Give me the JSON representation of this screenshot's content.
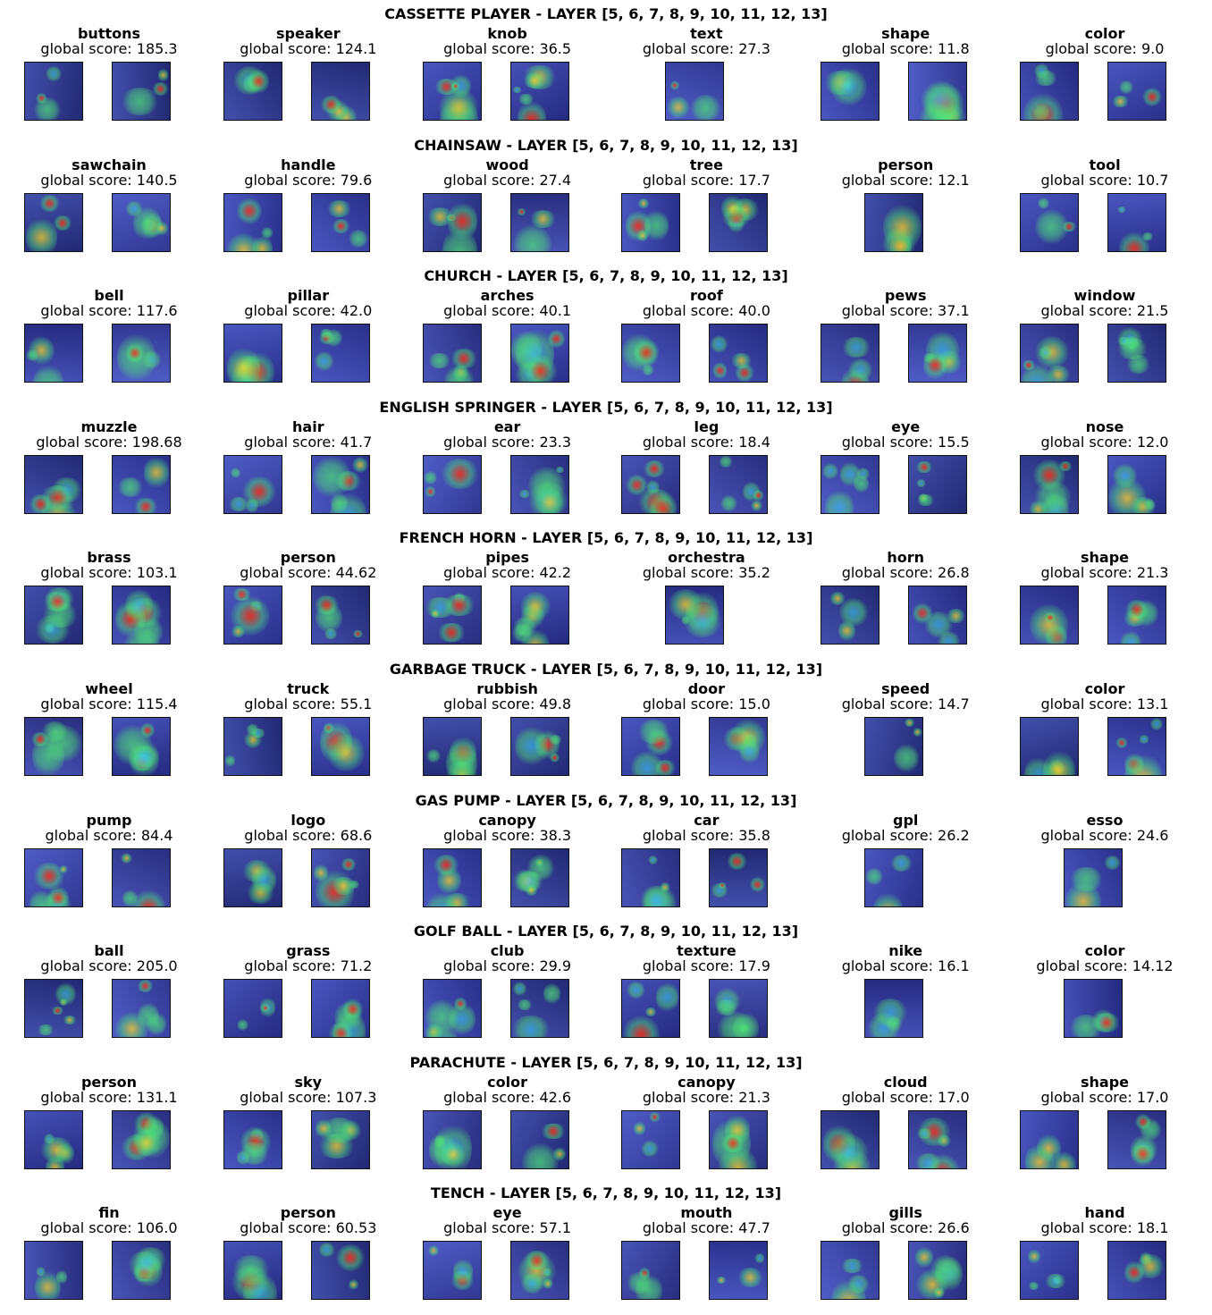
{
  "sections": [
    {
      "title": "CASSETTE PLAYER - LAYER [5, 6, 7, 8, 9, 10, 11, 12, 13]",
      "concepts": [
        {
          "name": "buttons",
          "score": "global score: 185.3",
          "thumbs": 2
        },
        {
          "name": "speaker",
          "score": "global score: 124.1",
          "thumbs": 2
        },
        {
          "name": "knob",
          "score": "global score: 36.5",
          "thumbs": 2
        },
        {
          "name": "text",
          "score": "global score: 27.3",
          "thumbs": 1
        },
        {
          "name": "shape",
          "score": "global score: 11.8",
          "thumbs": 2
        },
        {
          "name": "color",
          "score": "global score: 9.0",
          "thumbs": 2
        }
      ]
    },
    {
      "title": "CHAINSAW - LAYER [5, 6, 7, 8, 9, 10, 11, 12, 13]",
      "concepts": [
        {
          "name": "sawchain",
          "score": "global score: 140.5",
          "thumbs": 2
        },
        {
          "name": "handle",
          "score": "global score: 79.6",
          "thumbs": 2
        },
        {
          "name": "wood",
          "score": "global score: 27.4",
          "thumbs": 2
        },
        {
          "name": "tree",
          "score": "global score: 17.7",
          "thumbs": 2
        },
        {
          "name": "person",
          "score": "global score: 12.1",
          "thumbs": 1
        },
        {
          "name": "tool",
          "score": "global score: 10.7",
          "thumbs": 2
        }
      ]
    },
    {
      "title": "CHURCH - LAYER [5, 6, 7, 8, 9, 10, 11, 12, 13]",
      "concepts": [
        {
          "name": "bell",
          "score": "global score: 117.6",
          "thumbs": 2
        },
        {
          "name": "pillar",
          "score": "global score: 42.0",
          "thumbs": 2
        },
        {
          "name": "arches",
          "score": "global score: 40.1",
          "thumbs": 2
        },
        {
          "name": "roof",
          "score": "global score: 40.0",
          "thumbs": 2
        },
        {
          "name": "pews",
          "score": "global score: 37.1",
          "thumbs": 2
        },
        {
          "name": "window",
          "score": "global score: 21.5",
          "thumbs": 2
        }
      ]
    },
    {
      "title": "ENGLISH SPRINGER - LAYER [5, 6, 7, 8, 9, 10, 11, 12, 13]",
      "concepts": [
        {
          "name": "muzzle",
          "score": "global score: 198.68",
          "thumbs": 2
        },
        {
          "name": "hair",
          "score": "global score: 41.7",
          "thumbs": 2
        },
        {
          "name": "ear",
          "score": "global score: 23.3",
          "thumbs": 2
        },
        {
          "name": "leg",
          "score": "global score: 18.4",
          "thumbs": 2
        },
        {
          "name": "eye",
          "score": "global score: 15.5",
          "thumbs": 2
        },
        {
          "name": "nose",
          "score": "global score: 12.0",
          "thumbs": 2
        }
      ]
    },
    {
      "title": "FRENCH HORN - LAYER [5, 6, 7, 8, 9, 10, 11, 12, 13]",
      "concepts": [
        {
          "name": "brass",
          "score": "global score: 103.1",
          "thumbs": 2
        },
        {
          "name": "person",
          "score": "global score: 44.62",
          "thumbs": 2
        },
        {
          "name": "pipes",
          "score": "global score: 42.2",
          "thumbs": 2
        },
        {
          "name": "orchestra",
          "score": "global score: 35.2",
          "thumbs": 1
        },
        {
          "name": "horn",
          "score": "global score: 26.8",
          "thumbs": 2
        },
        {
          "name": "shape",
          "score": "global score: 21.3",
          "thumbs": 2
        }
      ]
    },
    {
      "title": "GARBAGE TRUCK - LAYER [5, 6, 7, 8, 9, 10, 11, 12, 13]",
      "concepts": [
        {
          "name": "wheel",
          "score": "global score: 115.4",
          "thumbs": 2
        },
        {
          "name": "truck",
          "score": "global score: 55.1",
          "thumbs": 2
        },
        {
          "name": "rubbish",
          "score": "global score: 49.8",
          "thumbs": 2
        },
        {
          "name": "door",
          "score": "global score: 15.0",
          "thumbs": 2
        },
        {
          "name": "speed",
          "score": "global score: 14.7",
          "thumbs": 1
        },
        {
          "name": "color",
          "score": "global score: 13.1",
          "thumbs": 2
        }
      ]
    },
    {
      "title": "GAS PUMP - LAYER [5, 6, 7, 8, 9, 10, 11, 12, 13]",
      "concepts": [
        {
          "name": "pump",
          "score": "global score: 84.4",
          "thumbs": 2
        },
        {
          "name": "logo",
          "score": "global score: 68.6",
          "thumbs": 2
        },
        {
          "name": "canopy",
          "score": "global score: 38.3",
          "thumbs": 2
        },
        {
          "name": "car",
          "score": "global score: 35.8",
          "thumbs": 2
        },
        {
          "name": "gpl",
          "score": "global score: 26.2",
          "thumbs": 1
        },
        {
          "name": "esso",
          "score": "global score: 24.6",
          "thumbs": 1
        }
      ]
    },
    {
      "title": "GOLF BALL - LAYER [5, 6, 7, 8, 9, 10, 11, 12, 13]",
      "concepts": [
        {
          "name": "ball",
          "score": "global score: 205.0",
          "thumbs": 2
        },
        {
          "name": "grass",
          "score": "global score: 71.2",
          "thumbs": 2
        },
        {
          "name": "club",
          "score": "global score: 29.9",
          "thumbs": 2
        },
        {
          "name": "texture",
          "score": "global score: 17.9",
          "thumbs": 2
        },
        {
          "name": "nike",
          "score": "global score: 16.1",
          "thumbs": 1
        },
        {
          "name": "color",
          "score": "global score: 14.12",
          "thumbs": 1
        }
      ]
    },
    {
      "title": "PARACHUTE - LAYER [5, 6, 7, 8, 9, 10, 11, 12, 13]",
      "concepts": [
        {
          "name": "person",
          "score": "global score: 131.1",
          "thumbs": 2
        },
        {
          "name": "sky",
          "score": "global score: 107.3",
          "thumbs": 2
        },
        {
          "name": "color",
          "score": "global score: 42.6",
          "thumbs": 2
        },
        {
          "name": "canopy",
          "score": "global score: 21.3",
          "thumbs": 2
        },
        {
          "name": "cloud",
          "score": "global score: 17.0",
          "thumbs": 2
        },
        {
          "name": "shape",
          "score": "global score: 17.0",
          "thumbs": 2
        }
      ]
    },
    {
      "title": "TENCH - LAYER [5, 6, 7, 8, 9, 10, 11, 12, 13]",
      "concepts": [
        {
          "name": "fin",
          "score": "global score: 106.0",
          "thumbs": 2
        },
        {
          "name": "person",
          "score": "global score: 60.53",
          "thumbs": 2
        },
        {
          "name": "eye",
          "score": "global score: 57.1",
          "thumbs": 2
        },
        {
          "name": "mouth",
          "score": "global score: 47.7",
          "thumbs": 2
        },
        {
          "name": "gills",
          "score": "global score: 26.6",
          "thumbs": 2
        },
        {
          "name": "hand",
          "score": "global score: 18.1",
          "thumbs": 2
        }
      ]
    }
  ]
}
